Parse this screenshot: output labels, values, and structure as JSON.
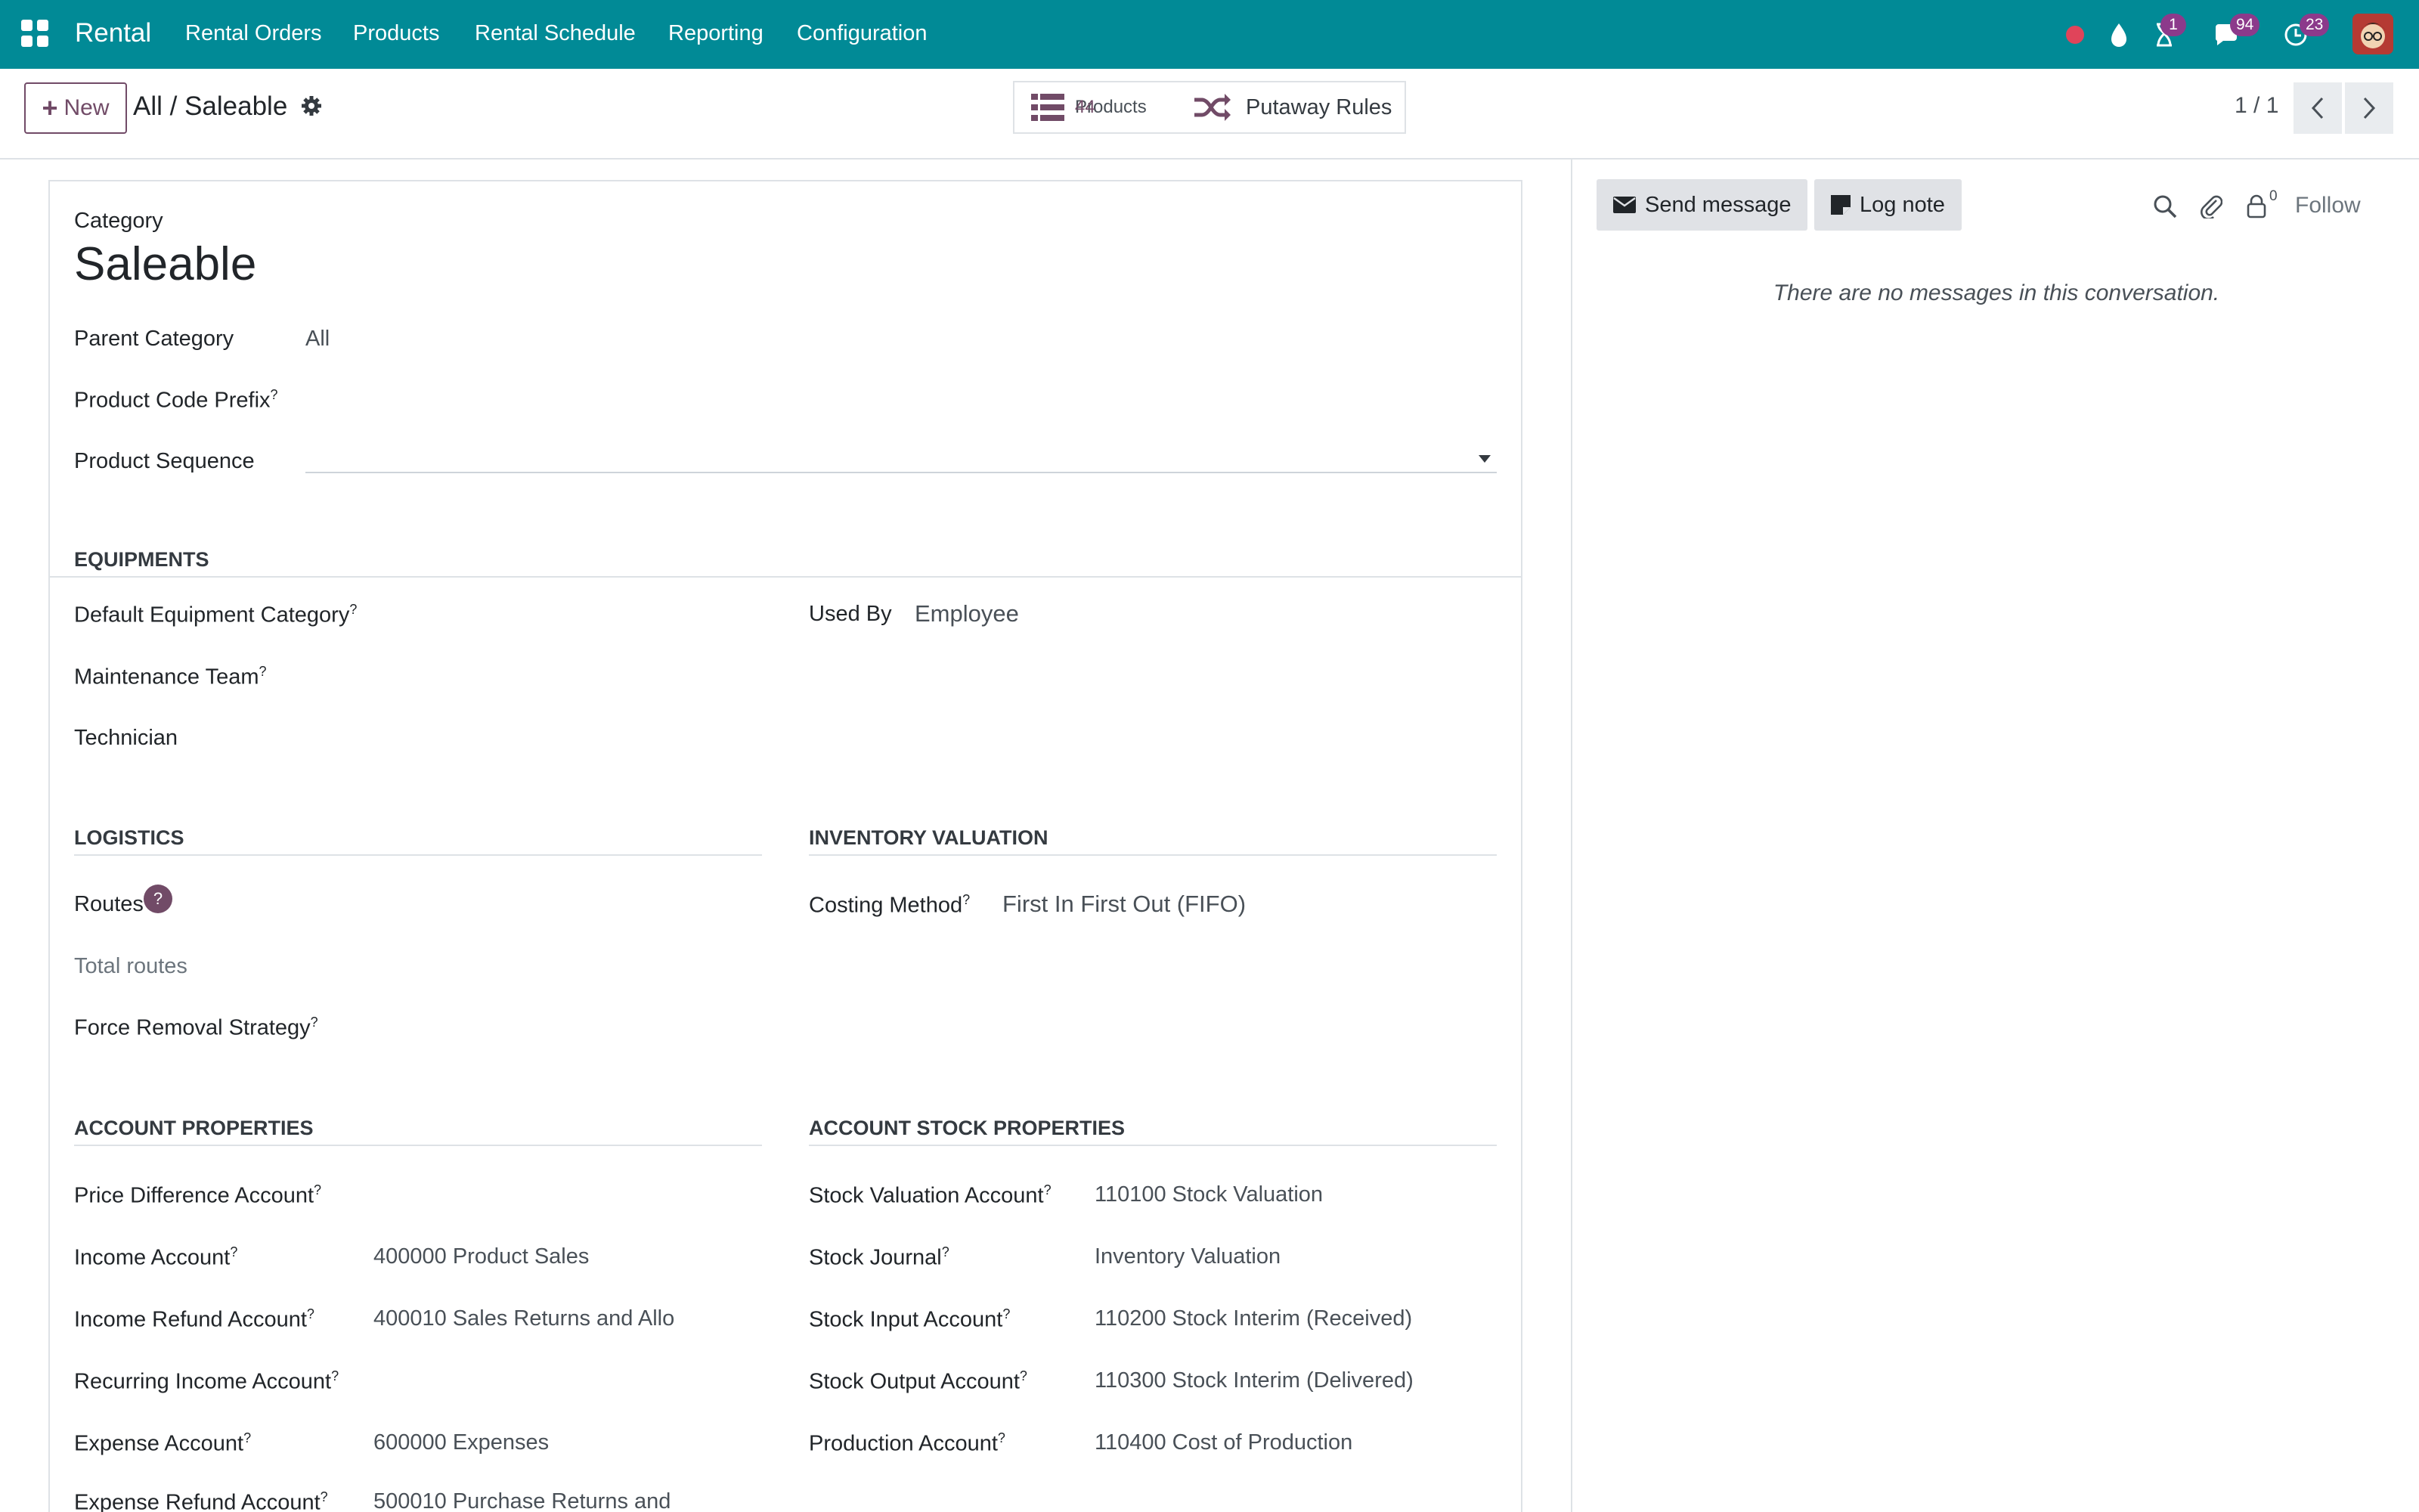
{
  "topbar": {
    "app_name": "Rental",
    "menu": [
      "Rental Orders",
      "Products",
      "Rental Schedule",
      "Reporting",
      "Configuration"
    ],
    "badges": {
      "activities": "1",
      "messages": "94",
      "updates": "23"
    },
    "icons": [
      "apps-grid-icon",
      "record-dot-icon",
      "drop-icon",
      "hourglass-icon",
      "chat-icon",
      "clock-icon",
      "user-avatar"
    ]
  },
  "control": {
    "new_label": "New",
    "breadcrumb": "All / Saleable",
    "smart_buttons": {
      "products_label": "Products",
      "products_count": "44",
      "putaway_label": "Putaway Rules"
    },
    "pager": "1 / 1"
  },
  "form": {
    "category_label": "Category",
    "name": "Saleable",
    "parent_category_label": "Parent Category",
    "parent_category_value": "All",
    "product_code_prefix_label": "Product Code Prefix",
    "product_sequence_label": "Product Sequence",
    "equipments": {
      "title": "EQUIPMENTS",
      "default_equipment_category_label": "Default Equipment Category",
      "maintenance_team_label": "Maintenance Team",
      "technician_label": "Technician",
      "used_by_label": "Used By",
      "used_by_value": "Employee"
    },
    "logistics": {
      "title": "LOGISTICS",
      "routes_label": "Routes",
      "total_routes_label": "Total routes",
      "force_removal_label": "Force Removal Strategy"
    },
    "inventory_valuation": {
      "title": "INVENTORY VALUATION",
      "costing_method_label": "Costing Method",
      "costing_method_value": "First In First Out (FIFO)"
    },
    "account_properties": {
      "title": "ACCOUNT PROPERTIES",
      "rows": [
        {
          "label": "Price Difference Account",
          "value": ""
        },
        {
          "label": "Income Account",
          "value": "400000 Product Sales"
        },
        {
          "label": "Income Refund Account",
          "value": "400010 Sales Returns and Allo"
        },
        {
          "label": "Recurring Income Account",
          "value": ""
        },
        {
          "label": "Expense Account",
          "value": "600000 Expenses"
        },
        {
          "label": "Expense Refund Account",
          "value": "500010 Purchase Returns and"
        }
      ]
    },
    "account_stock_properties": {
      "title": "ACCOUNT STOCK PROPERTIES",
      "rows": [
        {
          "label": "Stock Valuation Account",
          "value": "110100 Stock Valuation"
        },
        {
          "label": "Stock Journal",
          "value": "Inventory Valuation"
        },
        {
          "label": "Stock Input Account",
          "value": "110200 Stock Interim (Received)"
        },
        {
          "label": "Stock Output Account",
          "value": "110300 Stock Interim (Delivered)"
        },
        {
          "label": "Production Account",
          "value": "110400 Cost of Production"
        }
      ]
    }
  },
  "chatter": {
    "send_message": "Send message",
    "log_note": "Log note",
    "followers_count": "0",
    "follow": "Follow",
    "empty": "There are no messages in this conversation."
  },
  "colors": {
    "topbar": "#018a96",
    "primary": "#714b67",
    "badge": "#8c3a8b"
  }
}
